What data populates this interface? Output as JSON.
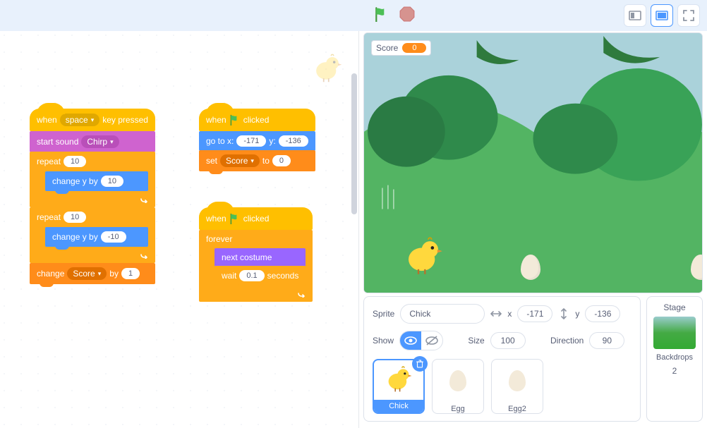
{
  "topbar": {},
  "scripts": {
    "stack1": {
      "when": "when",
      "key": "space",
      "keypressed": "key pressed",
      "startsound": "start sound",
      "sound": "Chirp",
      "repeat": "repeat",
      "repeat_n1": "10",
      "changey": "change y by",
      "cy1": "10",
      "repeat_n2": "10",
      "cy2": "-10",
      "change": "change",
      "var": "Score",
      "by": "by",
      "byval": "1"
    },
    "stack2": {
      "when": "when",
      "clicked": "clicked",
      "gotox": "go to x:",
      "x": "-171",
      "ylab": "y:",
      "y": "-136",
      "set": "set",
      "var": "Score",
      "to": "to",
      "val": "0"
    },
    "stack3": {
      "when": "when",
      "clicked": "clicked",
      "forever": "forever",
      "nextcostume": "next costume",
      "wait": "wait",
      "waitval": "0.1",
      "seconds": "seconds"
    }
  },
  "stage": {
    "score_label": "Score",
    "score_value": "0"
  },
  "info": {
    "sprite_lbl": "Sprite",
    "sprite_name": "Chick",
    "x_lbl": "x",
    "x": "-171",
    "y_lbl": "y",
    "y": "-136",
    "show_lbl": "Show",
    "size_lbl": "Size",
    "size": "100",
    "dir_lbl": "Direction",
    "dir": "90"
  },
  "sprites": {
    "s1": "Chick",
    "s2": "Egg",
    "s3": "Egg2"
  },
  "stagepanel": {
    "title": "Stage",
    "backdrops_lbl": "Backdrops",
    "backdrops_n": "2"
  }
}
